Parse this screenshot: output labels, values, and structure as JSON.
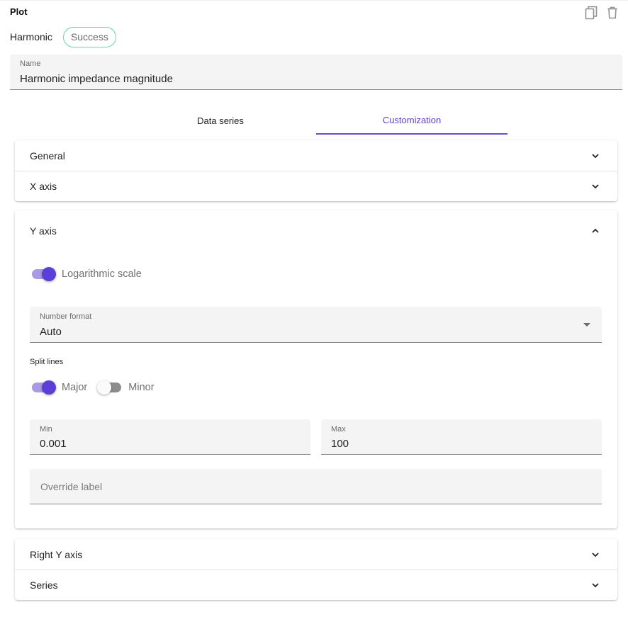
{
  "header": {
    "title": "Plot",
    "copy_icon": "copy-icon",
    "delete_icon": "trash-icon"
  },
  "plot": {
    "type_label": "Harmonic",
    "status": "Success",
    "status_color": "#67d6a7"
  },
  "name_field": {
    "label": "Name",
    "value": "Harmonic impedance magnitude"
  },
  "tabs": [
    {
      "label": "Data series",
      "active": false
    },
    {
      "label": "Customization",
      "active": true
    }
  ],
  "accent_color": "#5e3fcf",
  "sections": {
    "general": "General",
    "x_axis": "X axis",
    "y_axis": "Y axis",
    "right_y_axis": "Right Y axis",
    "series": "Series"
  },
  "y_axis": {
    "expanded": true,
    "logarithmic_scale": {
      "label": "Logarithmic scale",
      "on": true
    },
    "number_format": {
      "label": "Number format",
      "value": "Auto"
    },
    "split_lines": {
      "label": "Split lines",
      "major": {
        "label": "Major",
        "on": true
      },
      "minor": {
        "label": "Minor",
        "on": false
      }
    },
    "min": {
      "label": "Min",
      "value": "0.001"
    },
    "max": {
      "label": "Max",
      "value": "100"
    },
    "override_label": {
      "placeholder": "Override label",
      "value": ""
    }
  }
}
